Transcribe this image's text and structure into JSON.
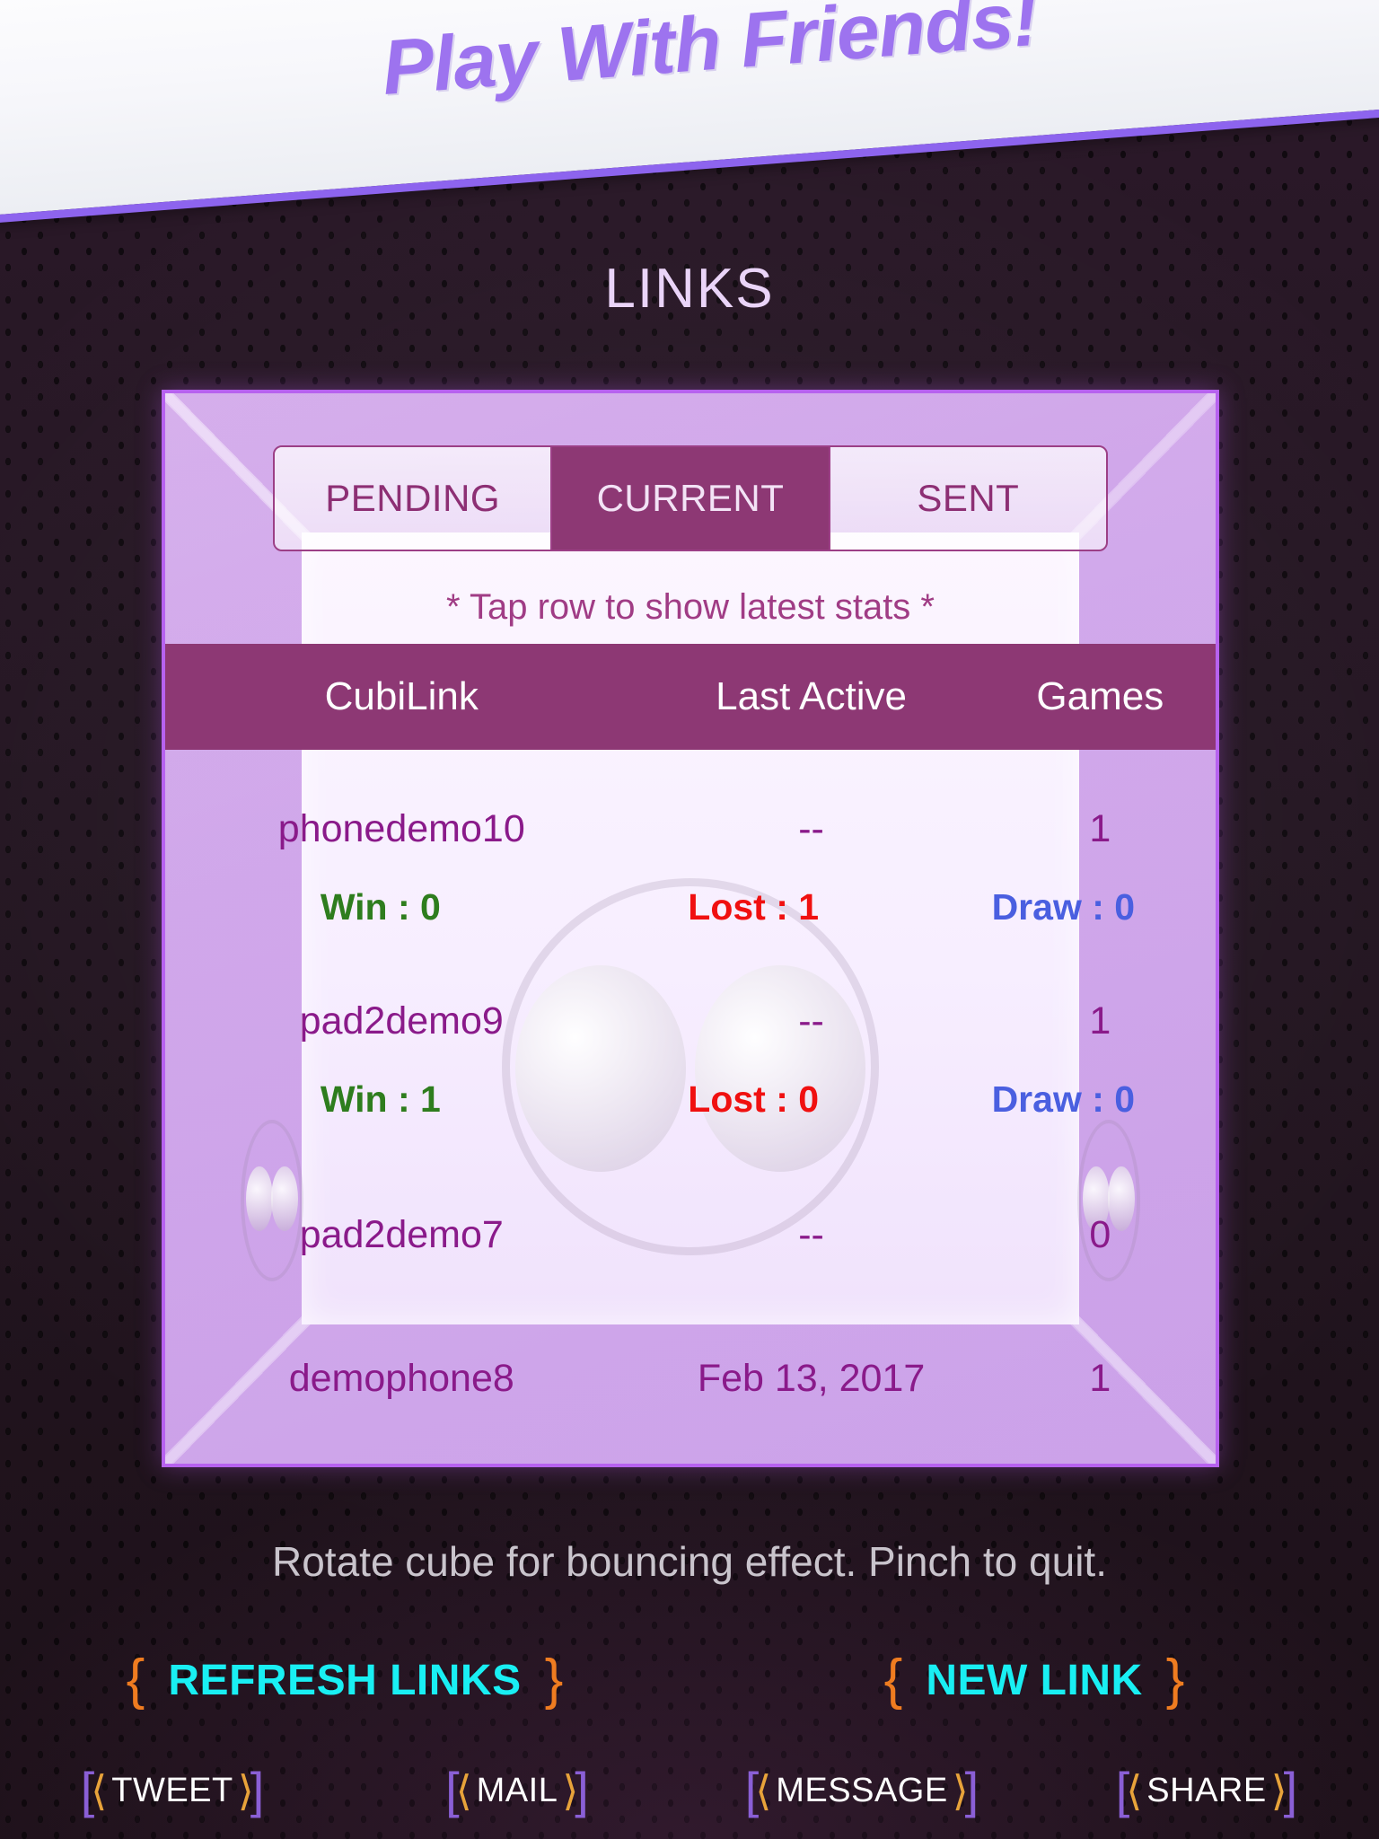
{
  "banner": {
    "title": "Play With Friends!"
  },
  "screen": {
    "title": "LINKS"
  },
  "tabs": [
    {
      "label": "PENDING",
      "active": false
    },
    {
      "label": "CURRENT",
      "active": true
    },
    {
      "label": "SENT",
      "active": false
    }
  ],
  "hint": "*  Tap row to show latest stats  *",
  "table": {
    "columns": [
      "CubiLink",
      "Last Active",
      "Games"
    ],
    "rows": [
      {
        "cubilink": "phonedemo10",
        "last_active": "--",
        "games": "1",
        "stats": {
          "win": "Win : 0",
          "lost": "Lost : 1",
          "draw": "Draw : 0"
        }
      },
      {
        "cubilink": "pad2demo9",
        "last_active": "--",
        "games": "1",
        "stats": {
          "win": "Win : 1",
          "lost": "Lost : 0",
          "draw": "Draw : 0"
        }
      },
      {
        "cubilink": "pad2demo7",
        "last_active": "--",
        "games": "0",
        "stats": null
      },
      {
        "cubilink": "demophone8",
        "last_active": "Feb 13, 2017",
        "games": "1",
        "stats": null
      }
    ]
  },
  "footer": {
    "hint": "Rotate cube for bouncing effect. Pinch to quit.",
    "actions": [
      {
        "open": "{",
        "label": "REFRESH LINKS",
        "close": "}"
      },
      {
        "open": "{",
        "label": "NEW LINK",
        "close": "}"
      }
    ],
    "share": [
      {
        "label": "TWEET"
      },
      {
        "label": "MAIL"
      },
      {
        "label": "MESSAGE"
      },
      {
        "label": "SHARE"
      }
    ],
    "bracket_left": "[",
    "bracket_right": "]",
    "angle_left": "⟨",
    "angle_right": "⟩"
  },
  "colors": {
    "accent_purple": "#9d73ef",
    "banner_rule": "#8d64ee",
    "cube_border": "#b762ef",
    "tab_active_bg": "#8d3874",
    "header_bg": "#8d3874",
    "link_text": "#8a1a8a",
    "win": "#2e7d1e",
    "lost": "#f01010",
    "draw": "#4a5fe0",
    "action_label": "#19eff3",
    "brace": "#ef7c20",
    "share_bracket": "#8a5fd6",
    "share_angle": "#e8a33a",
    "screen_title": "#ead4f8"
  }
}
